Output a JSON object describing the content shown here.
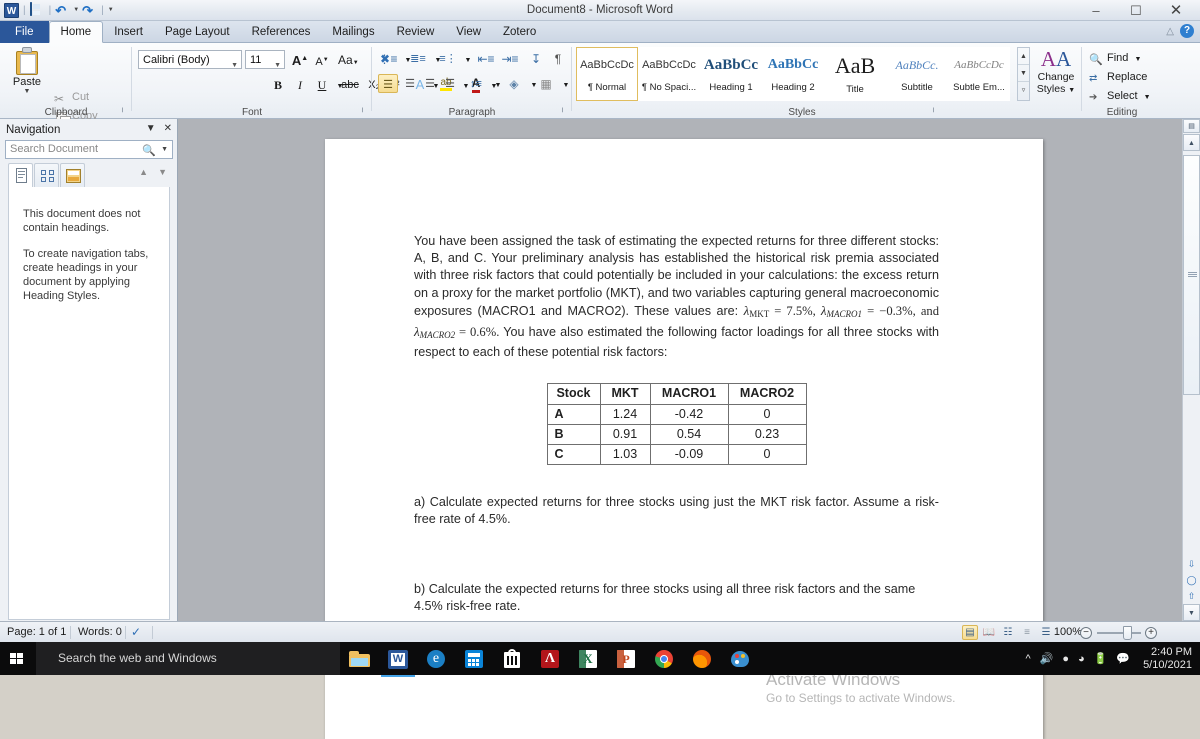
{
  "window": {
    "title": "Document8  -  Microsoft Word",
    "minimize": "–",
    "restore": "❐",
    "close": "✕",
    "help": "?",
    "minimize_ribbon": "△"
  },
  "quick_access": {
    "app_initial": "W",
    "items": [
      "save-icon",
      "undo-icon",
      "redo-icon",
      "customize-icon"
    ]
  },
  "ribbon": {
    "tabs": [
      {
        "label": "File",
        "active": false,
        "is_file": true
      },
      {
        "label": "Home",
        "active": true
      },
      {
        "label": "Insert",
        "active": false
      },
      {
        "label": "Page Layout",
        "active": false
      },
      {
        "label": "References",
        "active": false
      },
      {
        "label": "Mailings",
        "active": false
      },
      {
        "label": "Review",
        "active": false
      },
      {
        "label": "View",
        "active": false
      },
      {
        "label": "Zotero",
        "active": false
      }
    ],
    "clipboard": {
      "group_label": "Clipboard",
      "paste": "Paste",
      "cut": "Cut",
      "copy": "Copy",
      "format_painter": "Format Painter"
    },
    "font": {
      "group_label": "Font",
      "font_name": "Calibri (Body)",
      "font_size": "11",
      "grow_font": "A",
      "shrink_font": "A",
      "change_case": "Aa",
      "clear_formatting": "clear-formatting-icon",
      "bold": "B",
      "italic": "I",
      "underline": "U",
      "strikethrough": "abc",
      "subscript": "X₂",
      "superscript": "X²",
      "text_effects": "A",
      "highlight": "ab",
      "font_color": "A"
    },
    "paragraph": {
      "group_label": "Paragraph",
      "bullets": "bullets-icon",
      "numbering": "numbering-icon",
      "multilevel": "multilevel-list-icon",
      "decrease_indent": "decrease-indent-icon",
      "increase_indent": "increase-indent-icon",
      "sort": "sort-icon",
      "show_marks": "¶",
      "align_left": "align-left-icon",
      "align_center": "align-center-icon",
      "align_right": "align-right-icon",
      "justify": "justify-icon",
      "line_spacing": "line-spacing-icon",
      "shading": "shading-icon",
      "borders": "borders-icon"
    },
    "styles": {
      "group_label": "Styles",
      "gallery": [
        {
          "preview": "AaBbCcDc",
          "name": "¶ Normal",
          "selected": true
        },
        {
          "preview": "AaBbCcDc",
          "name": "¶ No Spaci...",
          "selected": false
        },
        {
          "preview": "AaBbCс",
          "name": "Heading 1",
          "selected": false
        },
        {
          "preview": "AaBbCc",
          "name": "Heading 2",
          "selected": false
        },
        {
          "preview": "AaB",
          "name": "Title",
          "selected": false
        },
        {
          "preview": "AaBbCc.",
          "name": "Subtitle",
          "selected": false
        },
        {
          "preview": "AaBbCcDс",
          "name": "Subtle Em...",
          "selected": false
        }
      ],
      "change_styles": "Change",
      "change_styles2": "Styles"
    },
    "editing": {
      "group_label": "Editing",
      "find": "Find",
      "replace": "Replace",
      "select": "Select"
    }
  },
  "navigation": {
    "title": "Navigation",
    "collapse": "▼",
    "close": "✕",
    "search_placeholder": "Search Document",
    "search_value": "",
    "tabs": [
      "headings-tab",
      "pages-tab",
      "results-tab"
    ],
    "nav_prev": "▲",
    "nav_next": "▼",
    "message_1": "This document does not contain headings.",
    "message_2": "To create navigation tabs, create headings in your document by applying Heading Styles."
  },
  "document": {
    "paragraph_1_part1": "You have been assigned the task of estimating the expected returns for three different stocks: A, B, and C. Your preliminary analysis has established the historical risk premia associated with three risk factors that could potentially be included in your calculations: the excess return on a proxy for the market portfolio (MKT), and two variables capturing general macroeconomic exposures (MACRO1 and MACRO2). These values are: ",
    "lambda": "λ",
    "mkt_sub": "MKT",
    "mkt_val": " = 7.5%, ",
    "macro1_sub": "MACRO1",
    "macro1_val": " = −0.3%,  and ",
    "macro2_sub": "MACRO2",
    "macro2_val": " = 0.6%. ",
    "paragraph_1_part2": "You have also estimated the following factor loadings for all three stocks with respect to each of these potential risk factors:",
    "table": {
      "headers": [
        "Stock",
        "MKT",
        "MACRO1",
        "MACRO2"
      ],
      "rows": [
        [
          "A",
          "1.24",
          "-0.42",
          "0"
        ],
        [
          "B",
          "0.91",
          "0.54",
          "0.23"
        ],
        [
          "C",
          "1.03",
          "-0.09",
          "0"
        ]
      ]
    },
    "question_a": "a) Calculate expected returns for three stocks using just the MKT risk factor. Assume a risk-free rate of 4.5%.",
    "question_b": "b) Calculate the expected returns for three stocks using all three risk factors and the same 4.5% risk-free rate."
  },
  "watermark": {
    "line1": "Activate Windows",
    "line2": "Go to Settings to activate Windows."
  },
  "status_bar": {
    "page": "Page: 1 of 1",
    "words": "Words: 0",
    "proofing": "proofing-icon",
    "views": [
      "print-layout-view",
      "full-screen-reading-view",
      "web-layout-view",
      "outline-view",
      "draft-view"
    ],
    "zoom": "100%",
    "zoom_out": "−",
    "zoom_in": "+"
  },
  "taskbar": {
    "start": "start-button",
    "search_placeholder": "Search the web and Windows",
    "apps": [
      "file-explorer",
      "microsoft-word",
      "microsoft-edge",
      "calculator",
      "microsoft-store",
      "adobe-reader",
      "microsoft-excel",
      "microsoft-powerpoint",
      "google-chrome",
      "mozilla-firefox",
      "paint-3d"
    ],
    "tray": [
      "show-hidden-icons",
      "volume-icon",
      "bluetooth-icon",
      "wifi-icon",
      "battery-icon",
      "action-center-icon"
    ],
    "time": "2:40 PM",
    "date": "5/10/2021"
  }
}
